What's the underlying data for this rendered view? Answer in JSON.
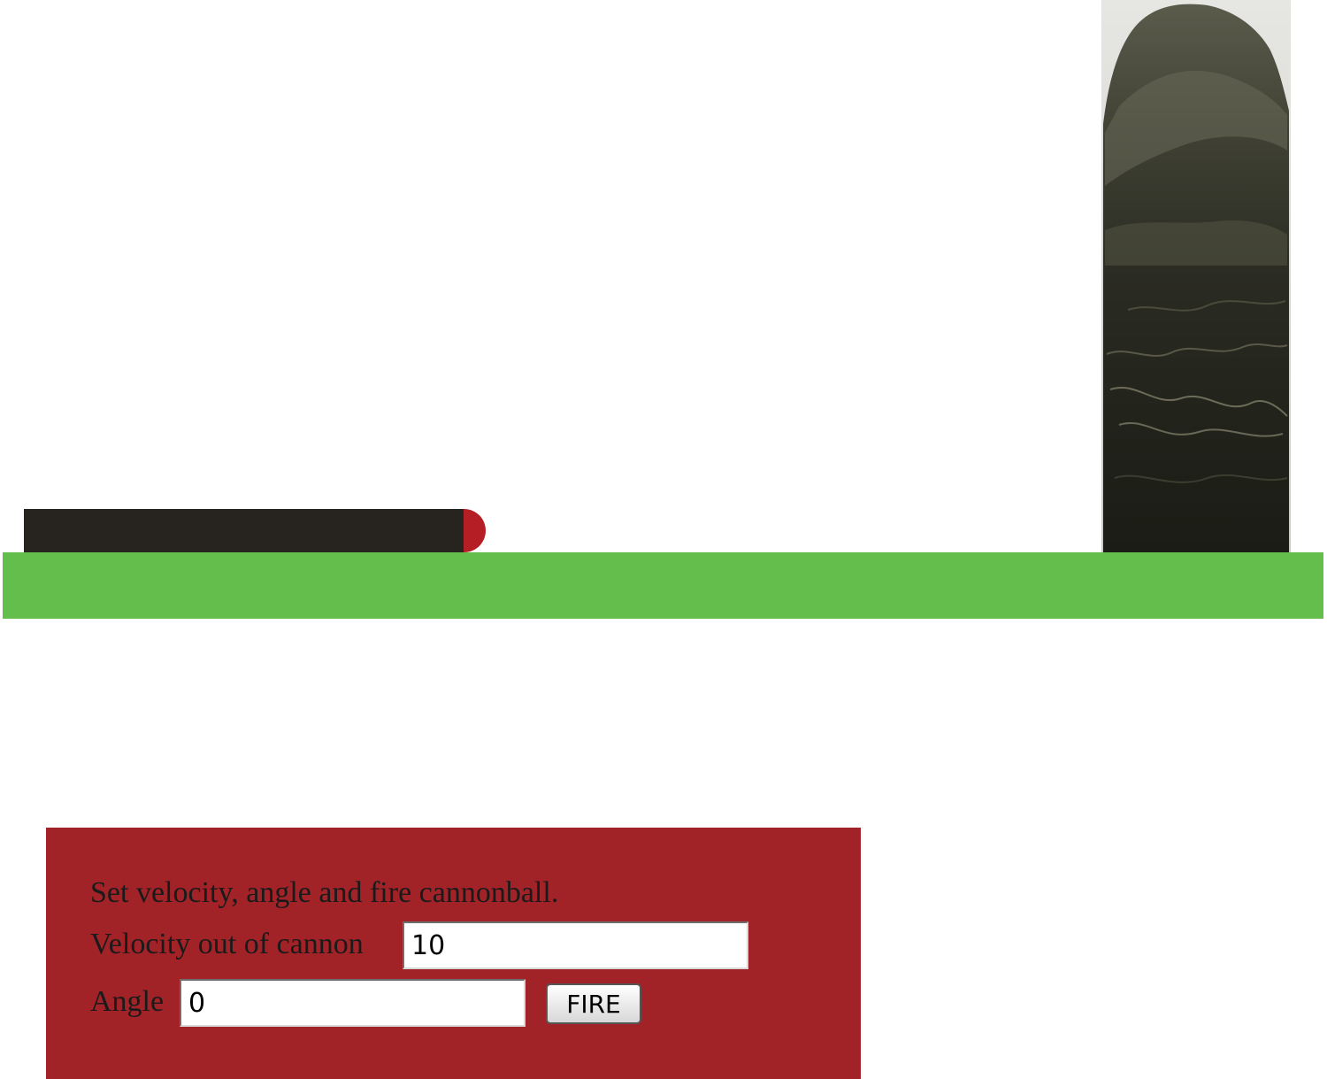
{
  "colors": {
    "background": "#ffffff",
    "ground": "#64be4b",
    "cannon": "#272420",
    "cannonball": "#b41e24",
    "control_panel": "#a12328",
    "target_dark": "#1e2018",
    "target_mid": "#3f4033",
    "sky_behind_target": "#dcdcd8"
  },
  "scene": {
    "cannon_icon": "cannon-barrel",
    "ball_icon": "cannonball",
    "target_icon": "rock-target-photo"
  },
  "controls": {
    "prompt": "Set velocity, angle and fire cannonball.",
    "velocity_label": "Velocity out of cannon",
    "velocity_value": "10",
    "angle_label": "Angle",
    "angle_value": "0",
    "fire_label": "FIRE"
  }
}
